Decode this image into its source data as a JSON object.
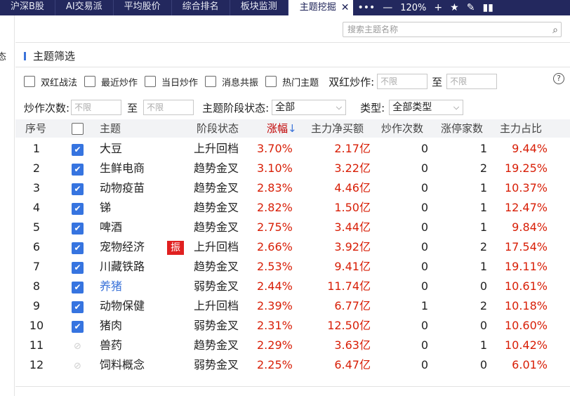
{
  "tabs": [
    {
      "label": "沪深B股",
      "active": false
    },
    {
      "label": "AI交易派",
      "active": false
    },
    {
      "label": "平均股价",
      "active": false
    },
    {
      "label": "综合排名",
      "active": false
    },
    {
      "label": "板块监测",
      "active": false
    },
    {
      "label": "主题挖掘",
      "active": true
    }
  ],
  "toolbar": {
    "close_glyph": "✕",
    "more_glyph": "•••",
    "minus_glyph": "—",
    "zoom": "120%",
    "plus_glyph": "+",
    "star_glyph": "★",
    "edit_glyph": "✎",
    "panel_glyph": "▮▮"
  },
  "left_edge_text": "态",
  "search": {
    "placeholder": "搜索主题名称",
    "icon": "search-icon"
  },
  "filter": {
    "title": "主题筛选",
    "checkboxes": [
      "双红战法",
      "最近炒作",
      "当日炒作",
      "消息共振",
      "热门主题"
    ],
    "shuanghong_label": "双红炒作:",
    "to_label": "至",
    "unlimited_placeholder": "不限",
    "chaozuo_label": "炒作次数:",
    "stage_label": "主题阶段状态:",
    "stage_value": "全部",
    "type_label": "类型:",
    "type_value": "全部类型",
    "help": "?"
  },
  "table": {
    "headers": {
      "idx": "序号",
      "name": "主题",
      "stage": "阶段状态",
      "pct": "涨幅",
      "net": "主力净买额",
      "cnt": "炒作次数",
      "lim": "涨停家数",
      "ratio": "主力占比"
    },
    "sort_arrow": "↓",
    "rows": [
      {
        "idx": "1",
        "checked": true,
        "name": "大豆",
        "badge": "",
        "stage": "上升回档",
        "pct": "3.70%",
        "net": "2.17亿",
        "cnt": "0",
        "lim": "1",
        "ratio": "9.44%"
      },
      {
        "idx": "2",
        "checked": true,
        "name": "生鲜电商",
        "badge": "",
        "stage": "趋势金叉",
        "pct": "3.10%",
        "net": "3.22亿",
        "cnt": "0",
        "lim": "2",
        "ratio": "19.25%"
      },
      {
        "idx": "3",
        "checked": true,
        "name": "动物疫苗",
        "badge": "",
        "stage": "趋势金叉",
        "pct": "2.83%",
        "net": "4.46亿",
        "cnt": "0",
        "lim": "1",
        "ratio": "10.37%"
      },
      {
        "idx": "4",
        "checked": true,
        "name": "锑",
        "badge": "",
        "stage": "趋势金叉",
        "pct": "2.82%",
        "net": "1.50亿",
        "cnt": "0",
        "lim": "1",
        "ratio": "12.47%"
      },
      {
        "idx": "5",
        "checked": true,
        "name": "啤酒",
        "badge": "",
        "stage": "趋势金叉",
        "pct": "2.75%",
        "net": "3.44亿",
        "cnt": "0",
        "lim": "1",
        "ratio": "9.84%"
      },
      {
        "idx": "6",
        "checked": true,
        "name": "宠物经济",
        "badge": "振",
        "stage": "上升回档",
        "pct": "2.66%",
        "net": "3.92亿",
        "cnt": "0",
        "lim": "2",
        "ratio": "17.54%"
      },
      {
        "idx": "7",
        "checked": true,
        "name": "川藏铁路",
        "badge": "",
        "stage": "趋势金叉",
        "pct": "2.53%",
        "net": "9.41亿",
        "cnt": "0",
        "lim": "1",
        "ratio": "19.11%"
      },
      {
        "idx": "8",
        "checked": true,
        "name": "养猪",
        "badge": "",
        "stage": "弱势金叉",
        "pct": "2.44%",
        "net": "11.74亿",
        "cnt": "0",
        "lim": "0",
        "ratio": "10.61%",
        "highlight": true
      },
      {
        "idx": "9",
        "checked": true,
        "name": "动物保健",
        "badge": "",
        "stage": "上升回档",
        "pct": "2.39%",
        "net": "6.77亿",
        "cnt": "1",
        "lim": "2",
        "ratio": "10.18%"
      },
      {
        "idx": "10",
        "checked": true,
        "name": "猪肉",
        "badge": "",
        "stage": "弱势金叉",
        "pct": "2.31%",
        "net": "12.50亿",
        "cnt": "0",
        "lim": "0",
        "ratio": "10.60%"
      },
      {
        "idx": "11",
        "checked": false,
        "name": "兽药",
        "badge": "",
        "stage": "趋势金叉",
        "pct": "2.29%",
        "net": "3.63亿",
        "cnt": "0",
        "lim": "1",
        "ratio": "10.42%"
      },
      {
        "idx": "12",
        "checked": false,
        "name": "饲料概念",
        "badge": "",
        "stage": "弱势金叉",
        "pct": "2.25%",
        "net": "6.47亿",
        "cnt": "0",
        "lim": "0",
        "ratio": "6.01%"
      }
    ]
  },
  "colors": {
    "tabbar": "#23285e",
    "up_red": "#d81e06",
    "accent_blue": "#3674e0",
    "badge_red": "#e02020"
  }
}
